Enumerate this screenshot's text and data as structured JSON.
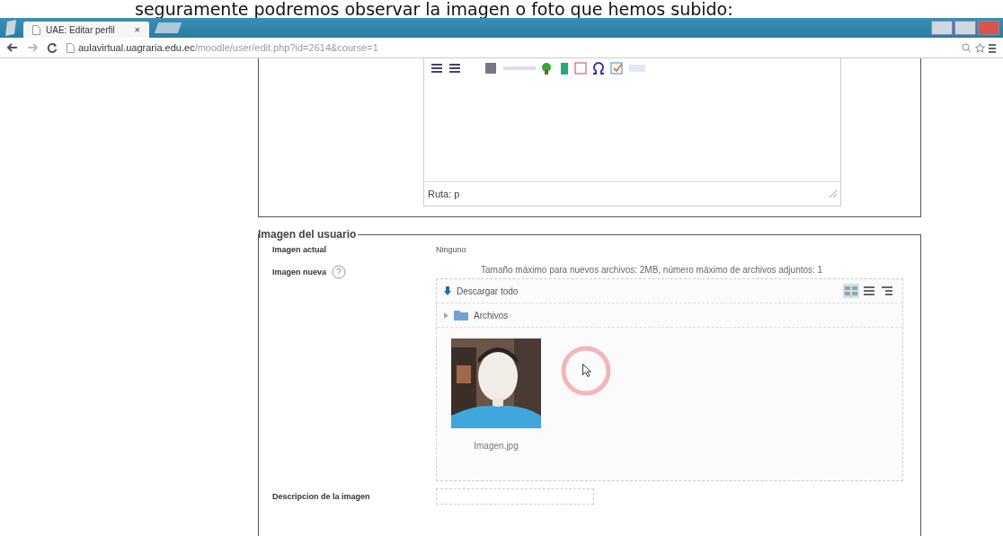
{
  "caption": "seguramente podremos observar la imagen o foto que hemos subido:",
  "browser": {
    "tab": {
      "title": "UAE: Editar perfil",
      "close": "×"
    },
    "url_host": "aulavirtual.uagraria.edu.ec",
    "url_path": "/moodle/user/edit.php?id=2614&course=1"
  },
  "editor": {
    "path": "Ruta: p"
  },
  "image_section": {
    "legend": "Imagen del usuario",
    "current": {
      "label": "Imagen actual",
      "value": "Ninguno"
    },
    "new": {
      "label": "Imagen nueva",
      "limits": "Tamaño máximo para nuevos archivos: 2MB, número máximo de archivos adjuntos: 1",
      "download_all": "Descargar todo",
      "folder": "Archivos",
      "view_modes": [
        {
          "kind": "icons",
          "selected": true
        },
        {
          "kind": "list",
          "selected": false
        },
        {
          "kind": "tree",
          "selected": false
        }
      ],
      "files": [
        {
          "name": "Imagen.jpg",
          "kind": "picture"
        }
      ]
    },
    "description": {
      "label": "Descripcion de la imagen"
    }
  }
}
